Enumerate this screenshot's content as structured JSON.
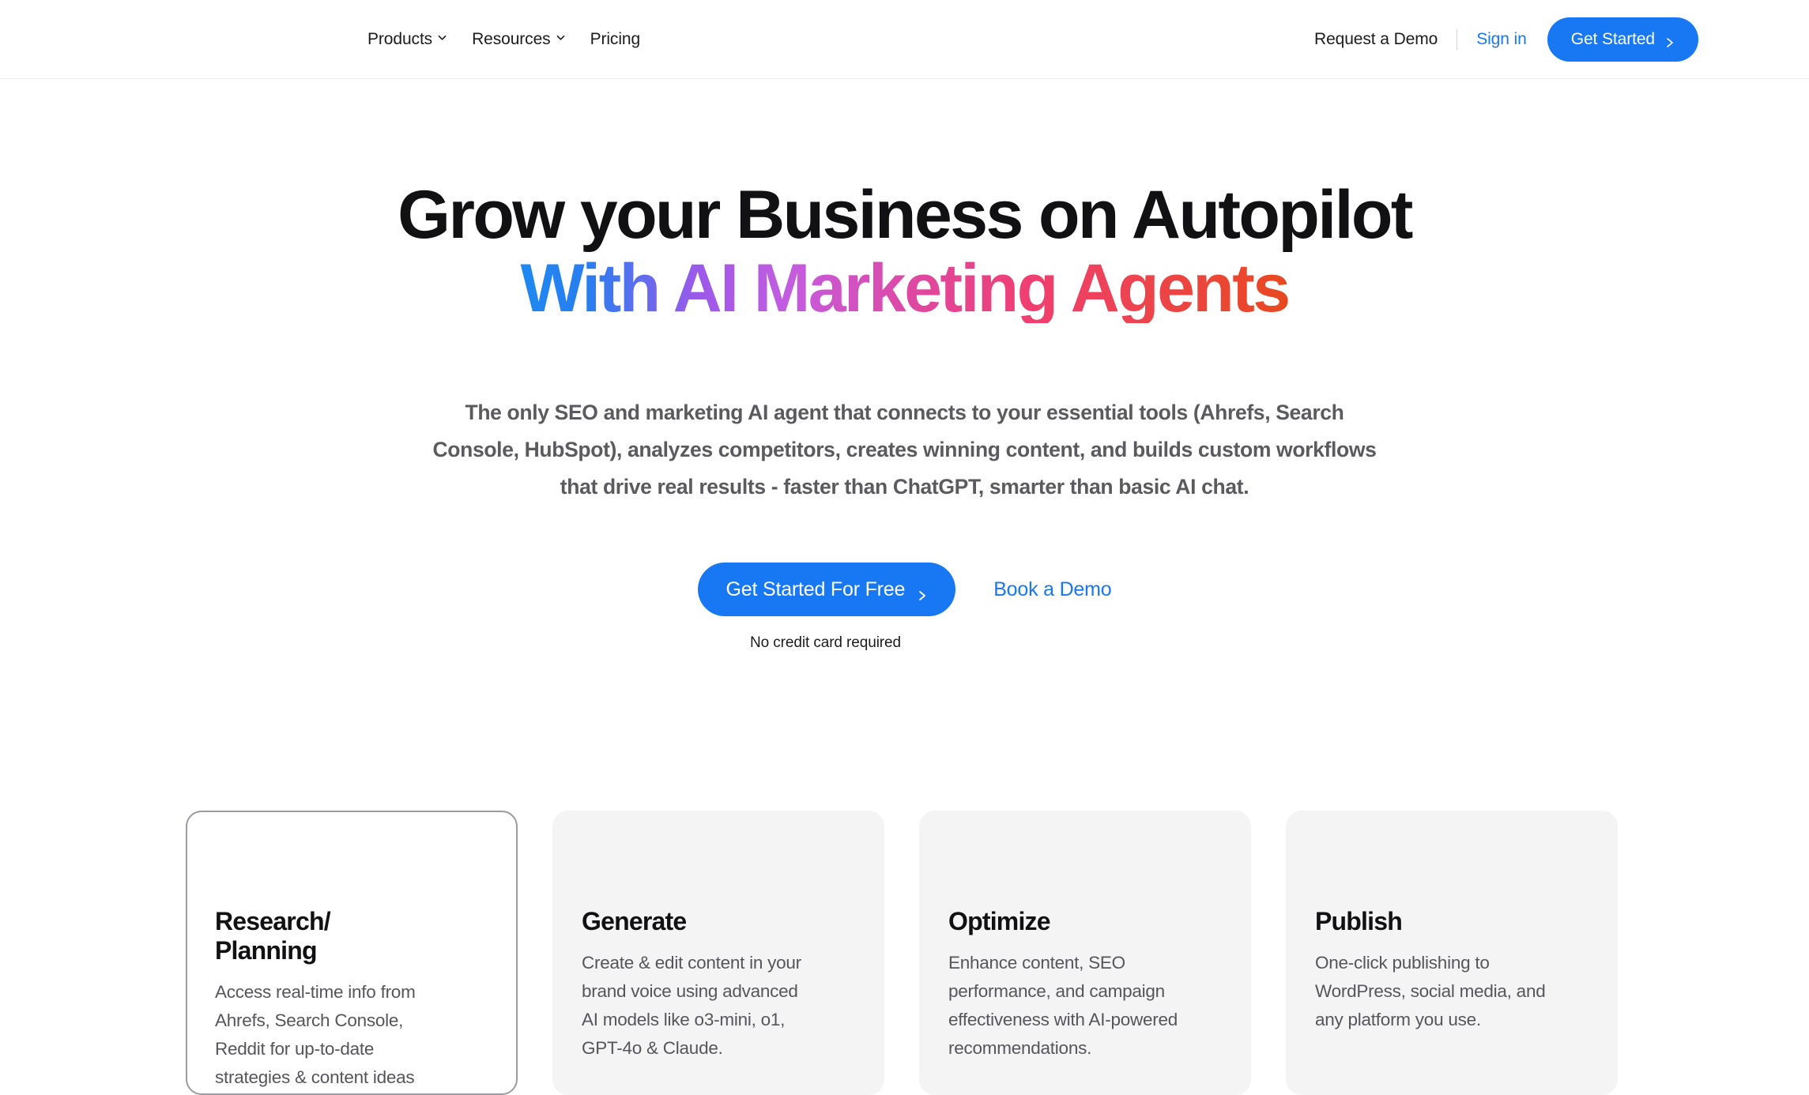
{
  "header": {
    "nav": [
      {
        "label": "Products",
        "has_dropdown": true,
        "icon": "chevron-down-icon"
      },
      {
        "label": "Resources",
        "has_dropdown": true,
        "icon": "chevron-down-icon"
      },
      {
        "label": "Pricing",
        "has_dropdown": false,
        "icon": ""
      }
    ],
    "request_demo_label": "Request a Demo",
    "signin_label": "Sign in",
    "get_started_label": "Get Started",
    "get_started_icon": "chevron-right-icon",
    "accent_color": "#1877f2",
    "divider_color": "#d4d4d8"
  },
  "hero": {
    "headline_line1": "Grow your Business on Autopilot",
    "headline_line2": "With AI Marketing Agents",
    "headline_gradient": [
      "#1e88f0",
      "#9b59ea",
      "#e0479f",
      "#e8481f"
    ],
    "subheadline": "The only SEO and marketing AI agent that connects to your essential tools (Ahrefs, Search Console, HubSpot), analyzes competitors, creates winning content, and builds custom workflows that drive real results - faster than ChatGPT, smarter than basic AI chat.",
    "primary_cta_label": "Get Started For Free",
    "primary_cta_icon": "chevron-right-icon",
    "secondary_cta_label": "Book a Demo",
    "note": "No credit card required"
  },
  "cards": [
    {
      "title": "Research/\nPlanning",
      "desc": "Access real-time info from\n Ahrefs, Search Console,\nReddit for up-to-date\nstrategies & content ideas",
      "active": true
    },
    {
      "title": "Generate",
      "desc": "Create & edit content in your\nbrand voice using advanced\nAI models like o3-mini, o1,\nGPT-4o & Claude.",
      "active": false
    },
    {
      "title": "Optimize",
      "desc": "Enhance content, SEO\nperformance, and campaign\neffectiveness with AI-powered\nrecommendations.",
      "active": false
    },
    {
      "title": "Publish",
      "desc": "One-click publishing to\nWordPress, social media, and\nany platform you use.",
      "active": false
    }
  ]
}
